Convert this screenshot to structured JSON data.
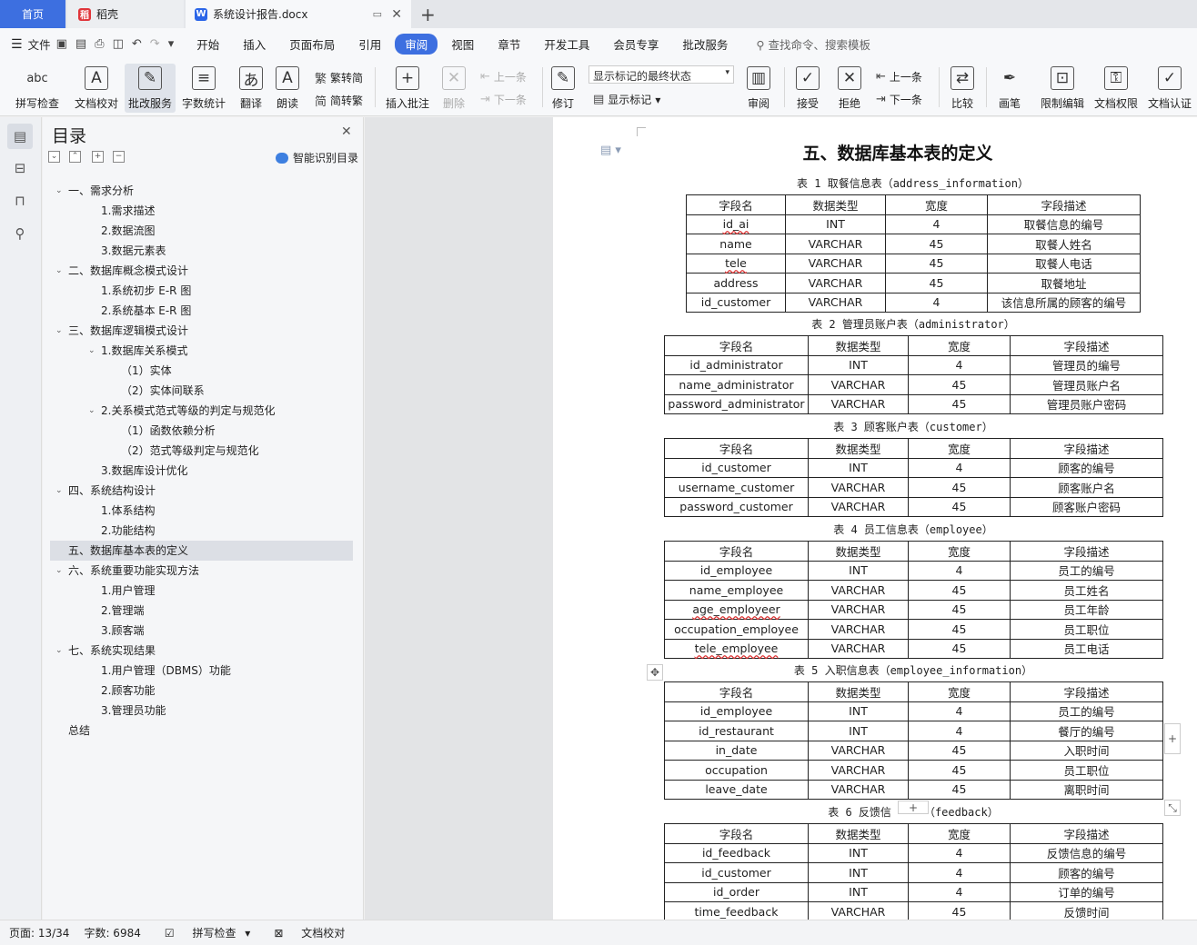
{
  "tabs": {
    "home": "首页",
    "daoke": "稻壳",
    "doc": "系统设计报告.docx",
    "doc_icon": "W",
    "daoke_icon": "稻"
  },
  "menu": {
    "file": "文件",
    "items": [
      "开始",
      "插入",
      "页面布局",
      "引用",
      "审阅",
      "视图",
      "章节",
      "开发工具",
      "会员专享",
      "批改服务"
    ],
    "search": "查找命令、搜索模板"
  },
  "ribbon": {
    "spell_check": "拼写检查",
    "doc_proof": "文档校对",
    "review_service": "批改服务",
    "word_count": "字数统计",
    "translate": "翻译",
    "read_aloud": "朗读",
    "trad_to_simp": "繁转简",
    "simp_to_trad": "简转繁",
    "insert_comment": "插入批注",
    "delete": "删除",
    "prev": "上一条",
    "next": "下一条",
    "revise": "修订",
    "markup_state": "显示标记的最终状态",
    "show_markup": "显示标记",
    "review": "审阅",
    "accept": "接受",
    "reject": "拒绝",
    "prev2": "上一条",
    "next2": "下一条",
    "compare": "比较",
    "pen": "画笔",
    "restrict_edit": "限制编辑",
    "doc_permission": "文档权限",
    "doc_cert": "文档认证",
    "abc": "abc"
  },
  "toc": {
    "title": "目录",
    "smart": "智能识别目录",
    "items": [
      {
        "text": "一、需求分析",
        "level": 1,
        "chev": true
      },
      {
        "text": "1.需求描述",
        "level": 2
      },
      {
        "text": "2.数据流图",
        "level": 2
      },
      {
        "text": "3.数据元素表",
        "level": 2
      },
      {
        "text": "二、数据库概念模式设计",
        "level": 1,
        "chev": true
      },
      {
        "text": "1.系统初步 E-R 图",
        "level": 2
      },
      {
        "text": "2.系统基本 E-R 图",
        "level": 2
      },
      {
        "text": "三、数据库逻辑模式设计",
        "level": 1,
        "chev": true
      },
      {
        "text": "1.数据库关系模式",
        "level": 2,
        "chev": true
      },
      {
        "text": "（1）实体",
        "level": 3
      },
      {
        "text": "（2）实体间联系",
        "level": 3
      },
      {
        "text": "2.关系模式范式等级的判定与规范化",
        "level": 2,
        "chev": true
      },
      {
        "text": "（1）函数依赖分析",
        "level": 3
      },
      {
        "text": "（2）范式等级判定与规范化",
        "level": 3
      },
      {
        "text": "3.数据库设计优化",
        "level": 2
      },
      {
        "text": "四、系统结构设计",
        "level": 1,
        "chev": true
      },
      {
        "text": "1.体系结构",
        "level": 2
      },
      {
        "text": "2.功能结构",
        "level": 2
      },
      {
        "text": "五、数据库基本表的定义",
        "level": 1,
        "selected": true
      },
      {
        "text": "六、系统重要功能实现方法",
        "level": 1,
        "chev": true
      },
      {
        "text": "1.用户管理",
        "level": 2
      },
      {
        "text": "2.管理端",
        "level": 2
      },
      {
        "text": "3.顾客端",
        "level": 2
      },
      {
        "text": "七、系统实现结果",
        "level": 1,
        "chev": true
      },
      {
        "text": "1.用户管理（DBMS）功能",
        "level": 2
      },
      {
        "text": "2.顾客功能",
        "level": 2
      },
      {
        "text": "3.管理员功能",
        "level": 2
      },
      {
        "text": "总结",
        "level": 1
      }
    ]
  },
  "document": {
    "heading": "五、数据库基本表的定义",
    "header_row": [
      "字段名",
      "数据类型",
      "宽度",
      "字段描述"
    ],
    "tables": [
      {
        "caption": "表 1  取餐信息表（address_information）",
        "rows": [
          [
            "id_ai",
            "INT",
            "4",
            "取餐信息的编号"
          ],
          [
            "name",
            "VARCHAR",
            "45",
            "取餐人姓名"
          ],
          [
            "tele",
            "VARCHAR",
            "45",
            "取餐人电话"
          ],
          [
            "address",
            "VARCHAR",
            "45",
            "取餐地址"
          ],
          [
            "id_customer",
            "VARCHAR",
            "4",
            "该信息所属的顾客的编号"
          ]
        ]
      },
      {
        "caption": "表 2  管理员账户表（administrator）",
        "rows": [
          [
            "id_administrator",
            "INT",
            "4",
            "管理员的编号"
          ],
          [
            "name_administrator",
            "VARCHAR",
            "45",
            "管理员账户名"
          ],
          [
            "password_administrator",
            "VARCHAR",
            "45",
            "管理员账户密码"
          ]
        ]
      },
      {
        "caption": "表 3  顾客账户表（customer）",
        "rows": [
          [
            "id_customer",
            "INT",
            "4",
            "顾客的编号"
          ],
          [
            "username_customer",
            "VARCHAR",
            "45",
            "顾客账户名"
          ],
          [
            "password_customer",
            "VARCHAR",
            "45",
            "顾客账户密码"
          ]
        ]
      },
      {
        "caption": "表 4  员工信息表（employee）",
        "rows": [
          [
            "id_employee",
            "INT",
            "4",
            "员工的编号"
          ],
          [
            "name_employee",
            "VARCHAR",
            "45",
            "员工姓名"
          ],
          [
            "age_employeer",
            "VARCHAR",
            "45",
            "员工年龄"
          ],
          [
            "occupation_employee",
            "VARCHAR",
            "45",
            "员工职位"
          ],
          [
            "tele_employee",
            "VARCHAR",
            "45",
            "员工电话"
          ]
        ]
      },
      {
        "caption": "表 5  入职信息表（employee_information）",
        "rows": [
          [
            "id_employee",
            "INT",
            "4",
            "员工的编号"
          ],
          [
            "id_restaurant",
            "INT",
            "4",
            "餐厅的编号"
          ],
          [
            "in_date",
            "VARCHAR",
            "45",
            "入职时间"
          ],
          [
            "occupation",
            "VARCHAR",
            "45",
            "员工职位"
          ],
          [
            "leave_date",
            "VARCHAR",
            "45",
            "离职时间"
          ]
        ]
      },
      {
        "caption_left": "表 6  反馈信",
        "caption_right": "（feedback）",
        "rows": [
          [
            "id_feedback",
            "INT",
            "4",
            "反馈信息的编号"
          ],
          [
            "id_customer",
            "INT",
            "4",
            "顾客的编号"
          ],
          [
            "id_order",
            "INT",
            "4",
            "订单的编号"
          ],
          [
            "time_feedback",
            "VARCHAR",
            "45",
            "反馈时间"
          ]
        ]
      }
    ]
  },
  "status": {
    "page": "页面: 13/34",
    "words": "字数: 6984",
    "spell": "拼写检查",
    "proof": "文档校对"
  }
}
